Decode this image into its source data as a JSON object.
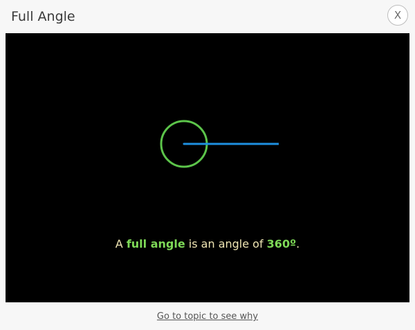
{
  "dialog": {
    "title": "Full Angle",
    "close_label": "X"
  },
  "illustration": {
    "arc_color": "#5cc44a",
    "ray_color": "#1e90e0",
    "background_color": "#000000"
  },
  "caption": {
    "prefix": "A ",
    "term": "full angle",
    "middle": " is an angle of ",
    "value": "360º",
    "suffix": "."
  },
  "footer": {
    "link_label": "Go to topic to see why"
  }
}
